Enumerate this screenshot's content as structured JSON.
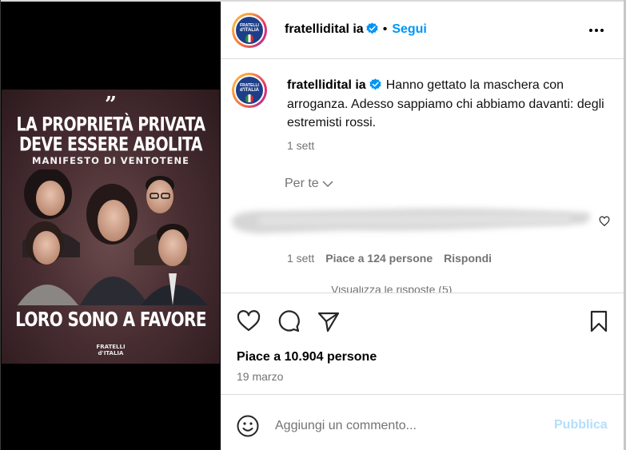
{
  "media": {
    "quote_mark": "”",
    "headline_line1": "LA PROPRIETÀ PRIVATA",
    "headline_line2": "DEVE ESSERE ABOLITA",
    "subtitle": "MANIFESTO DI VENTOTENE",
    "cta": "LORO SONO A FAVORE",
    "brand_line1": "FRATELLI",
    "brand_line2": "d'ITALIA"
  },
  "header": {
    "username": "fratellidital ia",
    "separator": "•",
    "follow_label": "Segui",
    "avatar_text_top": "FRATELLI",
    "avatar_text_bottom": "d'ITALIA"
  },
  "caption": {
    "username": "fratellidital ia",
    "text": "Hanno gettato la maschera con arroganza. Adesso sappiamo chi abbiamo davanti: degli estremisti rossi.",
    "time": "1 sett"
  },
  "comments": {
    "sort_label": "Per te",
    "comment_time": "1 sett",
    "comment_likes": "Piace a 124 persone",
    "reply_label": "Rispondi",
    "view_replies": "Visualizza le risposte (5)"
  },
  "post": {
    "likes": "Piace a 10.904 persone",
    "date": "19 marzo"
  },
  "add_comment": {
    "placeholder": "Aggiungi un commento...",
    "publish_label": "Pubblica"
  },
  "icons": [
    "more-icon",
    "verified-icon",
    "chevron-down-icon",
    "heart-icon",
    "comment-icon",
    "share-icon",
    "bookmark-icon",
    "emoji-icon"
  ],
  "colors": {
    "accent": "#0095f6",
    "publish_disabled": "#b2dffc",
    "secondary_text": "#737373",
    "divider": "#dbdbdb"
  }
}
